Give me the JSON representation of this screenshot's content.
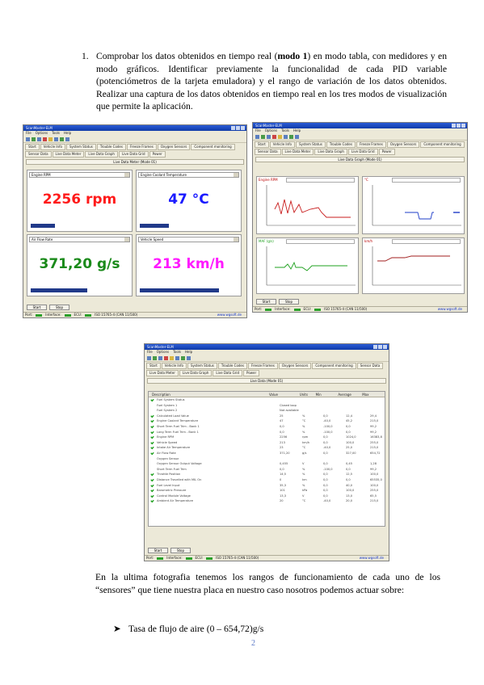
{
  "doc": {
    "item_number": "1.",
    "item_text_before_bold": "Comprobar los datos obtenidos en tiempo real (",
    "item_text_bold": "modo 1",
    "item_text_after_bold": ") en modo tabla, con medidores y en modo gráficos. Identificar previamente la funcionalidad de cada PID variable (potenciómetros de la tarjeta emuladora) y el rango de variación de los datos obtenidos. Realizar una captura de los datos obtenidos en tiempo real en los tres modos de visualización que permite la aplicación.",
    "paragraph2": "En la ultima fotografia tenemos los rangos de funcionamiento de cada uno de los “sensores” que tiene nuestra placa en nuestro caso nosotros podemos actuar sobre:",
    "bullet_arrow": "➤",
    "bullet_text": "Tasa de flujo de aire (0 – 654,72)g/s",
    "page_number": "2"
  },
  "win1": {
    "title": "ScanMaster-ELM",
    "menu": [
      "File",
      "Options",
      "Tools",
      "Help"
    ],
    "tabs": [
      "Start",
      "Vehicle Info",
      "System Status",
      "Trouble Codes",
      "Freeze Frames",
      "Oxygen Sensors",
      "Component monitoring",
      "Sensor Data",
      "Live Data Meter",
      "Live Data Graph",
      "Live Data Grid",
      "Power"
    ],
    "panel_title": "Live Data Meter (Mode 01)",
    "meters": [
      {
        "label": "Engine RPM",
        "value": "2256 rpm",
        "color": "#ff1a1a",
        "level": 0.25
      },
      {
        "label": "Engine Coolant Temperature",
        "value": "47 °C",
        "color": "#1a1aff",
        "level": 0.3
      },
      {
        "label": "Air Flow Rate",
        "value": "371,20 g/s",
        "color": "#1a8a1a",
        "level": 0.58
      },
      {
        "label": "Vehicle Speed",
        "value": "213 km/h",
        "color": "#ff1aff",
        "level": 0.82
      }
    ],
    "buttons": [
      "Start",
      "Stop"
    ],
    "status": {
      "port": "Port:",
      "interface": "Interface:",
      "ecu": "ECU:",
      "protocol": "ISO 15765-4 (CAN 11/500)",
      "brand": "www.wgsoft.de"
    }
  },
  "win2": {
    "title": "ScanMaster-ELM",
    "menu": [
      "File",
      "Options",
      "Tools",
      "Help"
    ],
    "tabs": [
      "Start",
      "Vehicle Info",
      "System Status",
      "Trouble Codes",
      "Freeze Frames",
      "Oxygen Sensors",
      "Component monitoring",
      "Sensor Data",
      "Live Data Meter",
      "Live Data Graph",
      "Live Data Grid",
      "Power"
    ],
    "panel_title": "Live Data Graph (Mode 01)",
    "graphs": [
      {
        "label": "Engine RPM",
        "color": "#c81e1e"
      },
      {
        "label": "°C",
        "color": "#1e3cc8"
      },
      {
        "label": "MAF (g/s)",
        "color": "#1ea01e"
      },
      {
        "label": "km/h",
        "color": "#a01e1e"
      }
    ],
    "buttons": [
      "Start",
      "Stop"
    ],
    "status": {
      "port": "Port:",
      "interface": "Interface:",
      "ecu": "ECU:",
      "protocol": "ISO 15765-4 (CAN 11/500)",
      "brand": "www.wgsoft.de"
    }
  },
  "win3": {
    "title": "ScanMaster-ELM",
    "menu": [
      "File",
      "Options",
      "Tools",
      "Help"
    ],
    "tabs": [
      "Start",
      "Vehicle Info",
      "System Status",
      "Trouble Codes",
      "Freeze Frames",
      "Oxygen Sensors",
      "Component monitoring",
      "Sensor Data",
      "Live Data Meter",
      "Live Data Graph",
      "Live Data Grid",
      "Power"
    ],
    "panel_title": "Live Data (Mode 01)",
    "columns": [
      "Description",
      "Value",
      "Units",
      "Min",
      "Average",
      "Max"
    ],
    "rows": [
      {
        "d": "Fuel System Status",
        "v": "",
        "u": "",
        "mn": "",
        "av": "",
        "mx": "",
        "c": true
      },
      {
        "d": "Fuel System 1",
        "v": "Closed loop",
        "u": "",
        "mn": "",
        "av": "",
        "mx": "",
        "c": false
      },
      {
        "d": "Fuel System 2",
        "v": "Not available",
        "u": "",
        "mn": "",
        "av": "",
        "mx": "",
        "c": false
      },
      {
        "d": "Calculated Load Value",
        "v": "25",
        "u": "%",
        "mn": "0,0",
        "av": "12,4",
        "mx": "29,4",
        "c": true
      },
      {
        "d": "Engine Coolant Temperature",
        "v": "47",
        "u": "°C",
        "mn": "-40,0",
        "av": "45,2",
        "mx": "215,0",
        "c": true
      },
      {
        "d": "Short Term Fuel Trim - Bank 1",
        "v": "0,0",
        "u": "%",
        "mn": "-100,0",
        "av": "0,0",
        "mx": "99,2",
        "c": true
      },
      {
        "d": "Long Term Fuel Trim - Bank 1",
        "v": "0,0",
        "u": "%",
        "mn": "-100,0",
        "av": "0,0",
        "mx": "99,2",
        "c": true
      },
      {
        "d": "Engine RPM",
        "v": "2256",
        "u": "rpm",
        "mn": "0,0",
        "av": "1024,0",
        "mx": "16383,8",
        "c": true
      },
      {
        "d": "Vehicle Speed",
        "v": "213",
        "u": "km/h",
        "mn": "0,0",
        "av": "100,0",
        "mx": "255,0",
        "c": true
      },
      {
        "d": "Intake Air Temperature",
        "v": "23",
        "u": "°C",
        "mn": "-40,0",
        "av": "25,0",
        "mx": "215,0",
        "c": true
      },
      {
        "d": "Air Flow Rate",
        "v": "371,20",
        "u": "g/s",
        "mn": "0,0",
        "av": "327,00",
        "mx": "654,72",
        "c": true
      },
      {
        "d": "Oxygen Sensor",
        "v": "",
        "u": "",
        "mn": "",
        "av": "",
        "mx": "",
        "c": false
      },
      {
        "d": "Oxygen Sensor Output Voltage",
        "v": "0,455",
        "u": "V",
        "mn": "0,0",
        "av": "0,45",
        "mx": "1,28",
        "c": false
      },
      {
        "d": "Short Term Fuel Trim",
        "v": "0,0",
        "u": "%",
        "mn": "-100,0",
        "av": "0,0",
        "mx": "99,2",
        "c": false
      },
      {
        "d": "Throttle Position",
        "v": "14,5",
        "u": "%",
        "mn": "0,0",
        "av": "12,5",
        "mx": "100,0",
        "c": true
      },
      {
        "d": "Distance Travelled with MIL On",
        "v": "0",
        "u": "km",
        "mn": "0,0",
        "av": "0,0",
        "mx": "65535,0",
        "c": true
      },
      {
        "d": "Fuel Level Input",
        "v": "35,3",
        "u": "%",
        "mn": "0,0",
        "av": "40,0",
        "mx": "100,0",
        "c": true
      },
      {
        "d": "Barometric Pressure",
        "v": "101",
        "u": "kPa",
        "mn": "0,0",
        "av": "100,0",
        "mx": "255,0",
        "c": true
      },
      {
        "d": "Control Module Voltage",
        "v": "13,3",
        "u": "V",
        "mn": "0,0",
        "av": "13,0",
        "mx": "65,5",
        "c": true
      },
      {
        "d": "Ambient Air Temperature",
        "v": "20",
        "u": "°C",
        "mn": "-40,0",
        "av": "20,0",
        "mx": "215,0",
        "c": true
      }
    ],
    "buttons": [
      "Start",
      "Stop"
    ],
    "status": {
      "port": "Port:",
      "interface": "Interface:",
      "ecu": "ECU:",
      "protocol": "ISO 15765-4 (CAN 11/500)",
      "brand": "www.wgsoft.de"
    }
  }
}
